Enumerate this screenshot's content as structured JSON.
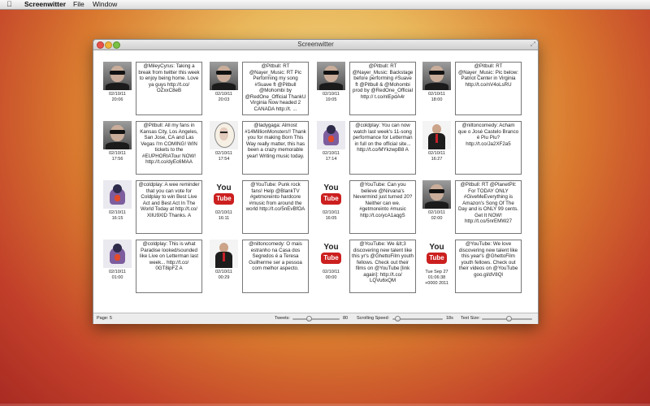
{
  "menubar": {
    "app_name": "Screenwitter",
    "items": [
      "File",
      "Window"
    ]
  },
  "window": {
    "title": "Screenwitter"
  },
  "tweets": [
    {
      "avatar": "man",
      "date": "02/10/11",
      "time": "20:06",
      "text": "@MileyCyrus: Taking a break from twitter this week to enjoy being home. Love ya guys  http://t.co/ OZxxC8eB"
    },
    {
      "avatar": "man",
      "date": "02/10/11",
      "time": "20:03",
      "text": "@Pitbull: RT @Nayer_Music: RT Pic Performing my song #Suave ft @Pitbull @Mohombi by @RedOne_Official ThankU Virginia Now headed 2 CANADA http://t. ..."
    },
    {
      "avatar": "man",
      "date": "02/10/11",
      "time": "19:05",
      "text": "@Pitbull: RT @Nayer_Music: Backstage before performing #Suave ft @Pitbull & @Mohombi prod by @RedOne_Official  http:// t.co/nlEpdA4r"
    },
    {
      "avatar": "man",
      "date": "02/10/11",
      "time": "18:00",
      "text": "@Pitbull: RT @Nayer_Music: Pic below: Patriot Center in Virginia http://t.co/nV4oLsRU"
    },
    {
      "avatar": "man",
      "date": "02/10/11",
      "time": "17:56",
      "text": "@Pitbull: All my fans in Kansas City, Los Angeles, San Jose, CA and Las Vegas I'm COMING! WIN tickets to the #EUPHORIATour NOW! http://t.co/dyEc6MAA"
    },
    {
      "avatar": "gaga",
      "date": "02/10/11",
      "time": "17:54",
      "text": "@ladygaga: Almost #14MillionMonsters!! Thank you for making Born This Way really matter, this has been a crazy memorable year!  Writing music today."
    },
    {
      "avatar": "coldplay",
      "date": "02/10/11",
      "time": "17:14",
      "text": "@coldplay: You can now watch last week's 11-song performance for Letterman in full on the official site... http://t.co/MYkzwpB8 A"
    },
    {
      "avatar": "nilton",
      "date": "02/10/11",
      "time": "16:27",
      "text": "@niltoncomedy: Acham que o José Castelo Branco é Piu Piu? http://t.co/Ja2XF2a5"
    },
    {
      "avatar": "coldplay",
      "date": "02/10/11",
      "time": "16:15",
      "text": "@coldplay: A wee reminder that you can vote for Coldplay to win Best Live Act and Best Act In The World Today at http://t.co/ XIlU9XlD Thanks. A"
    },
    {
      "avatar": "youtube",
      "date": "02/10/11",
      "time": "16:11",
      "text": "@YouTube: Punk rock fans! Help @BlankTV #getmoreinto hardcore #music from around the world http://t.co/5nEvBfOA"
    },
    {
      "avatar": "youtube",
      "date": "02/10/11",
      "time": "16:05",
      "text": "@YouTube: Can you believe @Nirvana's Nevermind just turned 20? Neither can we. #getmoreinto #music http://t.co/ycA1aqgS"
    },
    {
      "avatar": "man",
      "date": "02/10/11",
      "time": "02:00",
      "text": "@Pitbull: RT @PlanetPit: For TODAY ONLY #GiveMeEverything is Amazon's Song Of The Day and is ONLY 99 cents. Get It NOW! http://t.co/5nrEMW27"
    },
    {
      "avatar": "coldplay",
      "date": "02/10/11",
      "time": "01:00",
      "text": "@coldplay: This is what Paradise looked/sounded like Live on Letterman last week... http://t.co/ 0GT8ipFZ A"
    },
    {
      "avatar": "nilton",
      "date": "02/10/11",
      "time": "00:29",
      "text": "@niltoncomedy: O mais estranho na Casa dos Segredos é a Teresa Guilherme ser a pessoa com melhor aspecto."
    },
    {
      "avatar": "youtube",
      "date": "02/10/11",
      "time": "00:00",
      "text": "@YouTube: We &lt;3 discovering new talent like this yr's @GhettoFilm youth fellows. Check out their films on @YouTube [link again]: http://t.co/ LQVu6xQM"
    },
    {
      "avatar": "youtube",
      "date": "Tue Sep 27",
      "time": "01:06:38 +0000 2011",
      "text": "@YouTube: We love discovering new talent like this year's @GhettoFilm youth fellows.  Check out their videos on @YouTube goo.gl/dV8Ql"
    }
  ],
  "statusbar": {
    "page": "Page: 5",
    "tweets_label": "Tweets:",
    "tweets_value": "80",
    "tweets_fraction": 0.33,
    "speed_label": "Scrolling Speed:",
    "speed_value": "18s",
    "speed_fraction": 0.05,
    "textsize_label": "Text Size:",
    "textsize_fraction": 0.55
  },
  "youtube_logo": {
    "top": "You",
    "bottom": "Tube"
  }
}
